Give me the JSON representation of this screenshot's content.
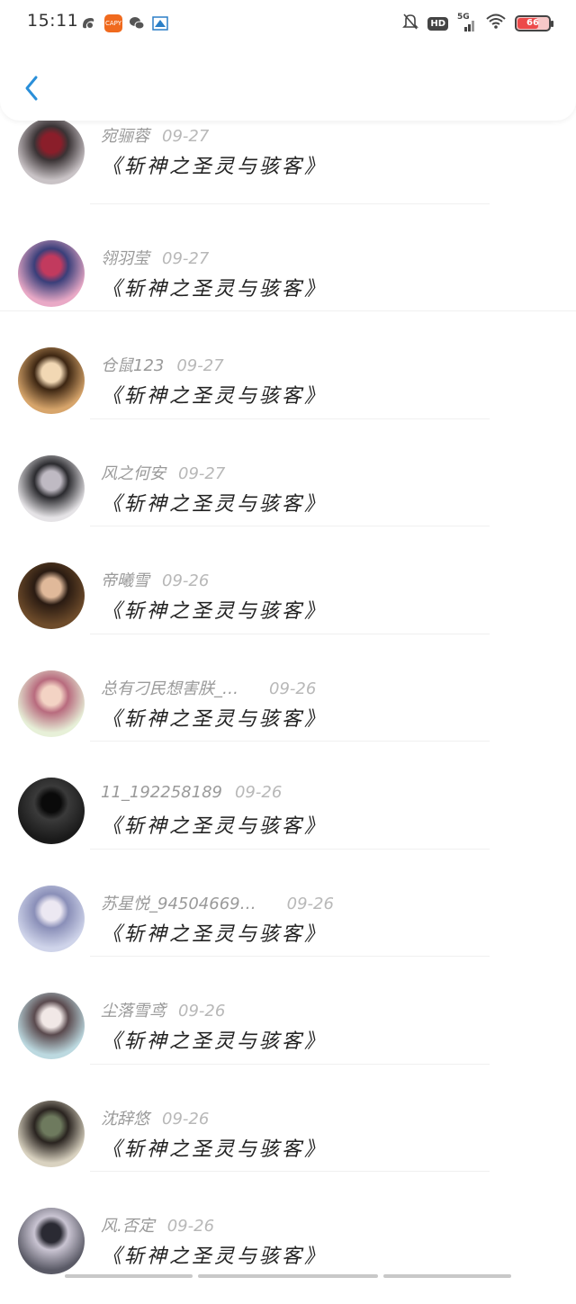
{
  "status_bar": {
    "time": "15:11",
    "network": "5G",
    "hd_label": "HD",
    "battery_level": "66",
    "app2_label": "CAPY"
  },
  "header": {
    "back_icon": "chevron-left-icon",
    "accent_color": "#2a8fd9"
  },
  "list": {
    "items": [
      {
        "name": "宛骊蓉",
        "date": "09-27",
        "title": "《斩神之圣灵与骇客》",
        "avatar_colors": [
          "#c9c3c6",
          "#3a3335",
          "#8a1e2a"
        ]
      },
      {
        "name": "翎羽莹",
        "date": "09-27",
        "title": "《斩神之圣灵与骇客》",
        "avatar_colors": [
          "#e9a9c6",
          "#3a3f7a",
          "#c23a5e"
        ]
      },
      {
        "name": "仓鼠123",
        "date": "09-27",
        "title": "《斩神之圣灵与骇客》",
        "avatar_colors": [
          "#d7a56b",
          "#3d2612",
          "#f2d8b4"
        ]
      },
      {
        "name": "风之何安",
        "date": "09-27",
        "title": "《斩神之圣灵与骇客》",
        "avatar_colors": [
          "#e5e3e6",
          "#2b2b2f",
          "#bfbac3"
        ]
      },
      {
        "name": "帝曦雪",
        "date": "09-26",
        "title": "《斩神之圣灵与骇客》",
        "avatar_colors": [
          "#6d4b2a",
          "#2a1b12",
          "#e0b99a"
        ]
      },
      {
        "name": "总有刁民想害朕_…",
        "date": "09-26",
        "title": "《斩神之圣灵与骇客》",
        "avatar_colors": [
          "#e7f0d8",
          "#b86b7e",
          "#f3d3c4"
        ]
      },
      {
        "name": "11_192258189",
        "date": "09-26",
        "title": "《斩神之圣灵与骇客》",
        "avatar_colors": [
          "#1a1a1a",
          "#3a3a3a",
          "#0a0a0a"
        ]
      },
      {
        "name": "苏星悦_94504669…",
        "date": "09-26",
        "title": "《斩神之圣灵与骇客》",
        "avatar_colors": [
          "#cfd4ea",
          "#8a8fb8",
          "#ece8f2"
        ]
      },
      {
        "name": "尘落雪鸢",
        "date": "09-26",
        "title": "《斩神之圣灵与骇客》",
        "avatar_colors": [
          "#bcd9e0",
          "#5a4a4e",
          "#f1e8e6"
        ]
      },
      {
        "name": "沈辞悠",
        "date": "09-26",
        "title": "《斩神之圣灵与骇客》",
        "avatar_colors": [
          "#d9d2c0",
          "#2a2420",
          "#6e7a5e"
        ]
      },
      {
        "name": "风.否定",
        "date": "09-26",
        "title": "《斩神之圣灵与骇客》",
        "avatar_colors": [
          "#5a5a66",
          "#c9c4d2",
          "#2a2a33"
        ]
      }
    ]
  }
}
